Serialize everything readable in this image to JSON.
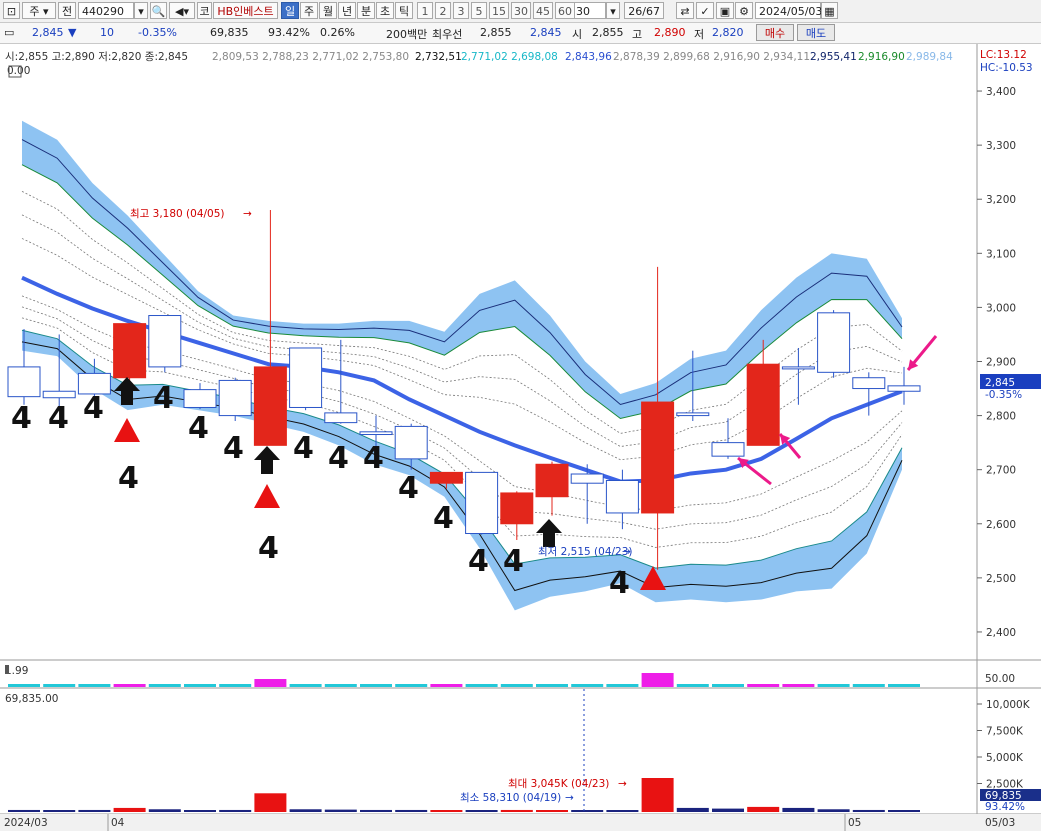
{
  "toolbar": {
    "market": "주",
    "prev_label": "전",
    "code": "440290",
    "type": "코",
    "name": "HB인베스트",
    "periods": [
      "일",
      "주",
      "월",
      "년",
      "분",
      "초",
      "틱"
    ],
    "periods_selected": "일",
    "numbers": [
      "1",
      "2",
      "3",
      "5",
      "15",
      "30",
      "45",
      "60"
    ],
    "count": "30",
    "page": "26/67",
    "date": "2024/05/03",
    "icons": [
      "window-icon",
      "search-icon",
      "sound-icon",
      "arrow-icon",
      "chart-tools-icon",
      "gear-icon",
      "calendar-icon"
    ]
  },
  "info": {
    "price": "2,845",
    "change_sign": "▼",
    "change": "10",
    "change_pct": "-0.35%",
    "volume": "69,835",
    "vol_ratio": "93.42%",
    "turnover": "0.26%",
    "amount": "200백만",
    "best_label": "최우선",
    "ask": "2,855",
    "bid": "2,845",
    "open_label": "시",
    "open": "2,855",
    "high_label": "고",
    "high": "2,890",
    "low_label": "저",
    "low": "2,820",
    "buy_label": "매수",
    "sell_label": "매도"
  },
  "legend": {
    "ohlc": "시:2,855 고:2,890 저:2,820 종:2,845",
    "values_gray1": "2,809,53 2,788,23 2,771,02 2,753,80",
    "value_black": "2,732,51",
    "values_cyan": "2,771,02 2,698,08",
    "value_blue": "2,843,96",
    "values_gray2": "2,878,39 2,899,68 2,916,90 2,934,11",
    "value_dark": "2,955,41",
    "value_green": "2,916,90",
    "value_light": "2,989,84",
    "corner_label": "0.00",
    "lc": "LC:13.12",
    "hc": "HC:-10.53"
  },
  "price_axis": {
    "ticks": [
      "3,400",
      "3,300",
      "3,200",
      "3,100",
      "3,000",
      "2,900",
      "2,800",
      "2,700",
      "2,600",
      "2,500",
      "2,400"
    ],
    "current": "2,845",
    "current_pct": "-0.35%"
  },
  "annotations": {
    "high": "최고 3,180 (04/05)",
    "low": "최저 2,515 (04/23)",
    "vol_max": "최대 3,045K (04/23)",
    "vol_min": "최소 58,310 (04/19)",
    "marker_digit": "4"
  },
  "sub1": {
    "label": "1.99",
    "tick": "50.00"
  },
  "sub2": {
    "label": "69,835.00",
    "ticks": [
      "10,000K",
      "7,500K",
      "5,000K",
      "2,500K"
    ],
    "current": "69,835",
    "current_pct": "93.42%"
  },
  "dates": [
    "2024/03",
    "04",
    "05",
    "05/03"
  ],
  "chart_data": {
    "type": "candlestick",
    "candles": [
      {
        "o": 2890,
        "h": 2960,
        "c": 2835,
        "l": 2820,
        "up": false
      },
      {
        "o": 2845,
        "h": 2950,
        "c": 2833,
        "l": 2810,
        "up": false
      },
      {
        "o": 2840,
        "h": 2905,
        "c": 2878,
        "l": 2830,
        "up": false
      },
      {
        "o": 2870,
        "h": 2970,
        "c": 2970,
        "l": 2855,
        "up": true
      },
      {
        "o": 2985,
        "h": 2985,
        "c": 2890,
        "l": 2880,
        "up": false
      },
      {
        "o": 2848,
        "h": 2860,
        "c": 2815,
        "l": 2812,
        "up": false
      },
      {
        "o": 2800,
        "h": 2870,
        "c": 2865,
        "l": 2790,
        "up": false
      },
      {
        "o": 2745,
        "h": 3180,
        "c": 2890,
        "l": 2745,
        "up": true
      },
      {
        "o": 2925,
        "h": 2925,
        "c": 2815,
        "l": 2810,
        "up": false
      },
      {
        "o": 2805,
        "h": 2940,
        "c": 2787,
        "l": 2785,
        "up": false
      },
      {
        "o": 2770,
        "h": 2800,
        "c": 2765,
        "l": 2715,
        "up": false
      },
      {
        "o": 2780,
        "h": 2785,
        "c": 2720,
        "l": 2700,
        "up": false
      },
      {
        "o": 2675,
        "h": 2695,
        "c": 2695,
        "l": 2665,
        "up": true
      },
      {
        "o": 2695,
        "h": 2695,
        "c": 2582,
        "l": 2580,
        "up": false
      },
      {
        "o": 2600,
        "h": 2660,
        "c": 2657,
        "l": 2570,
        "up": true
      },
      {
        "o": 2650,
        "h": 2715,
        "c": 2710,
        "l": 2615,
        "up": true
      },
      {
        "o": 2692,
        "h": 2710,
        "c": 2675,
        "l": 2600,
        "up": false
      },
      {
        "o": 2680,
        "h": 2700,
        "c": 2620,
        "l": 2590,
        "up": false
      },
      {
        "o": 2620,
        "h": 3075,
        "c": 2825,
        "l": 2515,
        "up": true
      },
      {
        "o": 2805,
        "h": 2920,
        "c": 2800,
        "l": 2790,
        "up": false
      },
      {
        "o": 2725,
        "h": 2795,
        "c": 2750,
        "l": 2720,
        "up": false
      },
      {
        "o": 2745,
        "h": 2940,
        "c": 2895,
        "l": 2745,
        "up": true
      },
      {
        "o": 2890,
        "h": 2925,
        "c": 2890,
        "l": 2820,
        "up": false
      },
      {
        "o": 2990,
        "h": 2995,
        "c": 2880,
        "l": 2870,
        "up": false
      },
      {
        "o": 2870,
        "h": 2880,
        "c": 2850,
        "l": 2800,
        "up": false
      },
      {
        "o": 2855,
        "h": 2890,
        "c": 2845,
        "l": 2820,
        "up": false
      }
    ],
    "ma_line": [
      3055,
      3025,
      2998,
      2975,
      2955,
      2935,
      2915,
      2895,
      2890,
      2880,
      2865,
      2830,
      2800,
      2770,
      2745,
      2722,
      2700,
      2678,
      2680,
      2693,
      2700,
      2720,
      2757,
      2795,
      2820,
      2845
    ],
    "band_upper": [
      3345,
      3310,
      3230,
      3170,
      3100,
      3030,
      2985,
      2975,
      2970,
      2970,
      2975,
      2975,
      2955,
      3025,
      3050,
      2985,
      2900,
      2840,
      2860,
      2905,
      2920,
      2995,
      3055,
      3100,
      3090,
      2980
    ],
    "band_lower": [
      2920,
      2910,
      2850,
      2810,
      2820,
      2810,
      2800,
      2785,
      2770,
      2745,
      2710,
      2690,
      2650,
      2555,
      2440,
      2465,
      2475,
      2490,
      2455,
      2460,
      2455,
      2460,
      2475,
      2480,
      2545,
      2700
    ],
    "vol_bars": [
      0.06,
      0.05,
      0.06,
      0.12,
      0.08,
      0.05,
      0.06,
      0.55,
      0.08,
      0.07,
      0.06,
      0.06,
      0.05,
      0.05,
      0.06,
      0.05,
      0.04,
      0.05,
      1.0,
      0.12,
      0.1,
      0.15,
      0.12,
      0.08,
      0.06,
      0.05
    ],
    "markers": [
      {
        "i": 0,
        "type": "digit"
      },
      {
        "i": 1,
        "type": "digit"
      },
      {
        "i": 2,
        "type": "digit"
      },
      {
        "i": 3,
        "type": "black-up",
        "digitAbove": false
      },
      {
        "i": 4,
        "type": "digit"
      },
      {
        "i": 5,
        "type": "digit"
      },
      {
        "i": 6,
        "type": "digit"
      },
      {
        "i": 7,
        "type": "black-up"
      },
      {
        "i": 8,
        "type": "digit"
      },
      {
        "i": 9,
        "type": "digit"
      },
      {
        "i": 10,
        "type": "digit"
      },
      {
        "i": 11,
        "type": "digit"
      },
      {
        "i": 12,
        "type": "digit"
      },
      {
        "i": 13,
        "type": "digit"
      },
      {
        "i": 14,
        "type": "digit"
      },
      {
        "i": 15,
        "type": "black-up"
      },
      {
        "i": 17,
        "type": "digit"
      }
    ],
    "red_triangles": [
      3,
      7,
      18
    ],
    "ylim": [
      2350,
      3450
    ]
  }
}
